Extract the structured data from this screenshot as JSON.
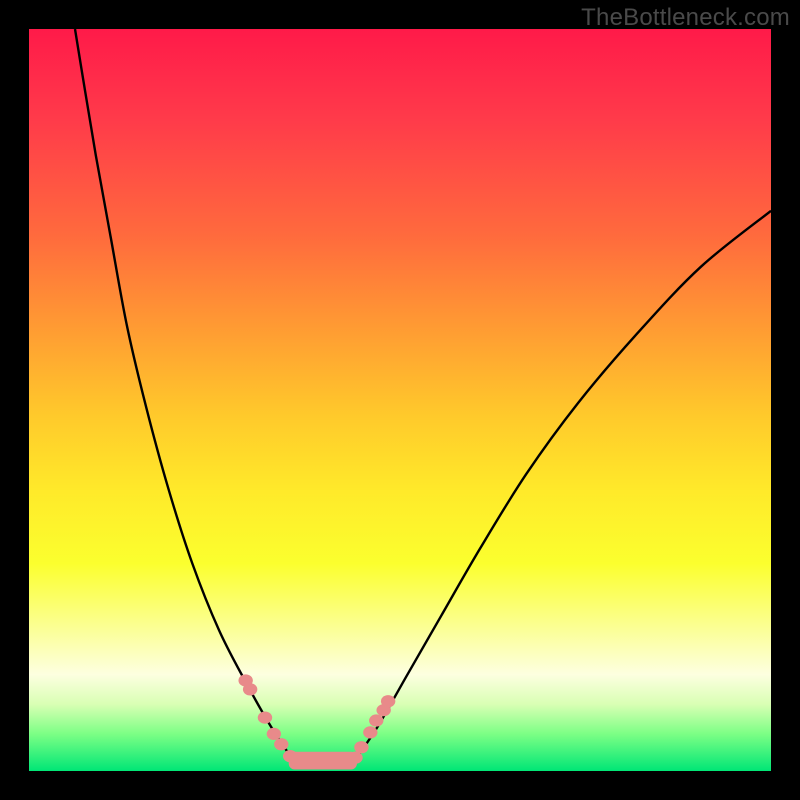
{
  "watermark": "TheBottleneck.com",
  "chart_data": {
    "type": "line",
    "title": "",
    "xlabel": "",
    "ylabel": "",
    "x_range": [
      0,
      1
    ],
    "y_range": [
      0,
      1
    ],
    "series": [
      {
        "name": "left-curve",
        "points": [
          [
            0.062,
            0.0
          ],
          [
            0.075,
            0.08
          ],
          [
            0.09,
            0.17
          ],
          [
            0.11,
            0.28
          ],
          [
            0.132,
            0.4
          ],
          [
            0.158,
            0.51
          ],
          [
            0.188,
            0.62
          ],
          [
            0.22,
            0.72
          ],
          [
            0.256,
            0.81
          ],
          [
            0.292,
            0.88
          ],
          [
            0.326,
            0.94
          ],
          [
            0.355,
            0.984
          ]
        ]
      },
      {
        "name": "right-curve",
        "points": [
          [
            0.44,
            0.984
          ],
          [
            0.47,
            0.94
          ],
          [
            0.51,
            0.87
          ],
          [
            0.556,
            0.79
          ],
          [
            0.608,
            0.7
          ],
          [
            0.67,
            0.6
          ],
          [
            0.74,
            0.504
          ],
          [
            0.82,
            0.41
          ],
          [
            0.906,
            0.32
          ],
          [
            1.0,
            0.245
          ]
        ]
      }
    ],
    "markers_left": [
      [
        0.292,
        0.878
      ],
      [
        0.298,
        0.89
      ],
      [
        0.318,
        0.928
      ],
      [
        0.33,
        0.95
      ],
      [
        0.34,
        0.964
      ],
      [
        0.352,
        0.98
      ]
    ],
    "markers_right": [
      [
        0.44,
        0.982
      ],
      [
        0.448,
        0.968
      ],
      [
        0.46,
        0.948
      ],
      [
        0.468,
        0.932
      ],
      [
        0.478,
        0.918
      ],
      [
        0.484,
        0.906
      ]
    ],
    "bottom_bar": {
      "x0": 0.35,
      "x1": 0.442,
      "y": 0.986,
      "h": 0.012
    },
    "gradient_note": "background encodes bottleneck severity: red (top) to green (bottom)"
  }
}
